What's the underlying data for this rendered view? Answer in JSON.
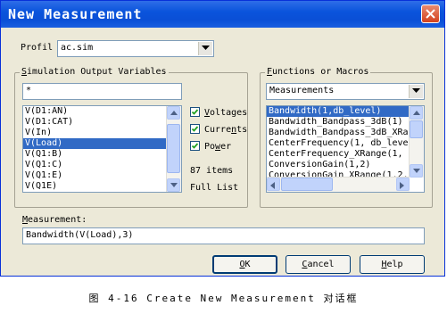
{
  "window": {
    "title": "New Measurement"
  },
  "profile": {
    "label": "Profil",
    "accel": "e",
    "value": "ac.sim"
  },
  "output_vars": {
    "group_label": "Simulation Output Variables",
    "filter_value": "*",
    "items": [
      "V(D1:AN)",
      "V(D1:CAT)",
      "V(In)",
      "V(Load)",
      "V(Q1:B)",
      "V(Q1:C)",
      "V(Q1:E)",
      "V(Q1E)"
    ],
    "selected_index": 3,
    "voltages_label": "Voltages",
    "voltages_checked": true,
    "currents_label": "Currents",
    "currents_checked": true,
    "power_label": "Power",
    "power_checked": true,
    "count_text": "87 items",
    "full_list_label": "Full List"
  },
  "functions": {
    "group_label": "Functions or Macros",
    "dropdown_value": "Measurements",
    "items": [
      "Bandwidth(1,db_level)",
      "Bandwidth_Bandpass_3dB(1)",
      "Bandwidth_Bandpass_3dB_XRa",
      "CenterFrequency(1, db_leve",
      "CenterFrequency_XRange(1,",
      "ConversionGain(1,2)",
      "ConversionGain_XRange(1,2,"
    ],
    "selected_index": 0
  },
  "measurement": {
    "label": "Measurement:",
    "accel": "M",
    "value": "Bandwidth(V(Load),3)"
  },
  "buttons": {
    "ok": "OK",
    "cancel": "Cancel",
    "help": "Help"
  },
  "caption": "图 4-16 Create New Measurement 对话框"
}
